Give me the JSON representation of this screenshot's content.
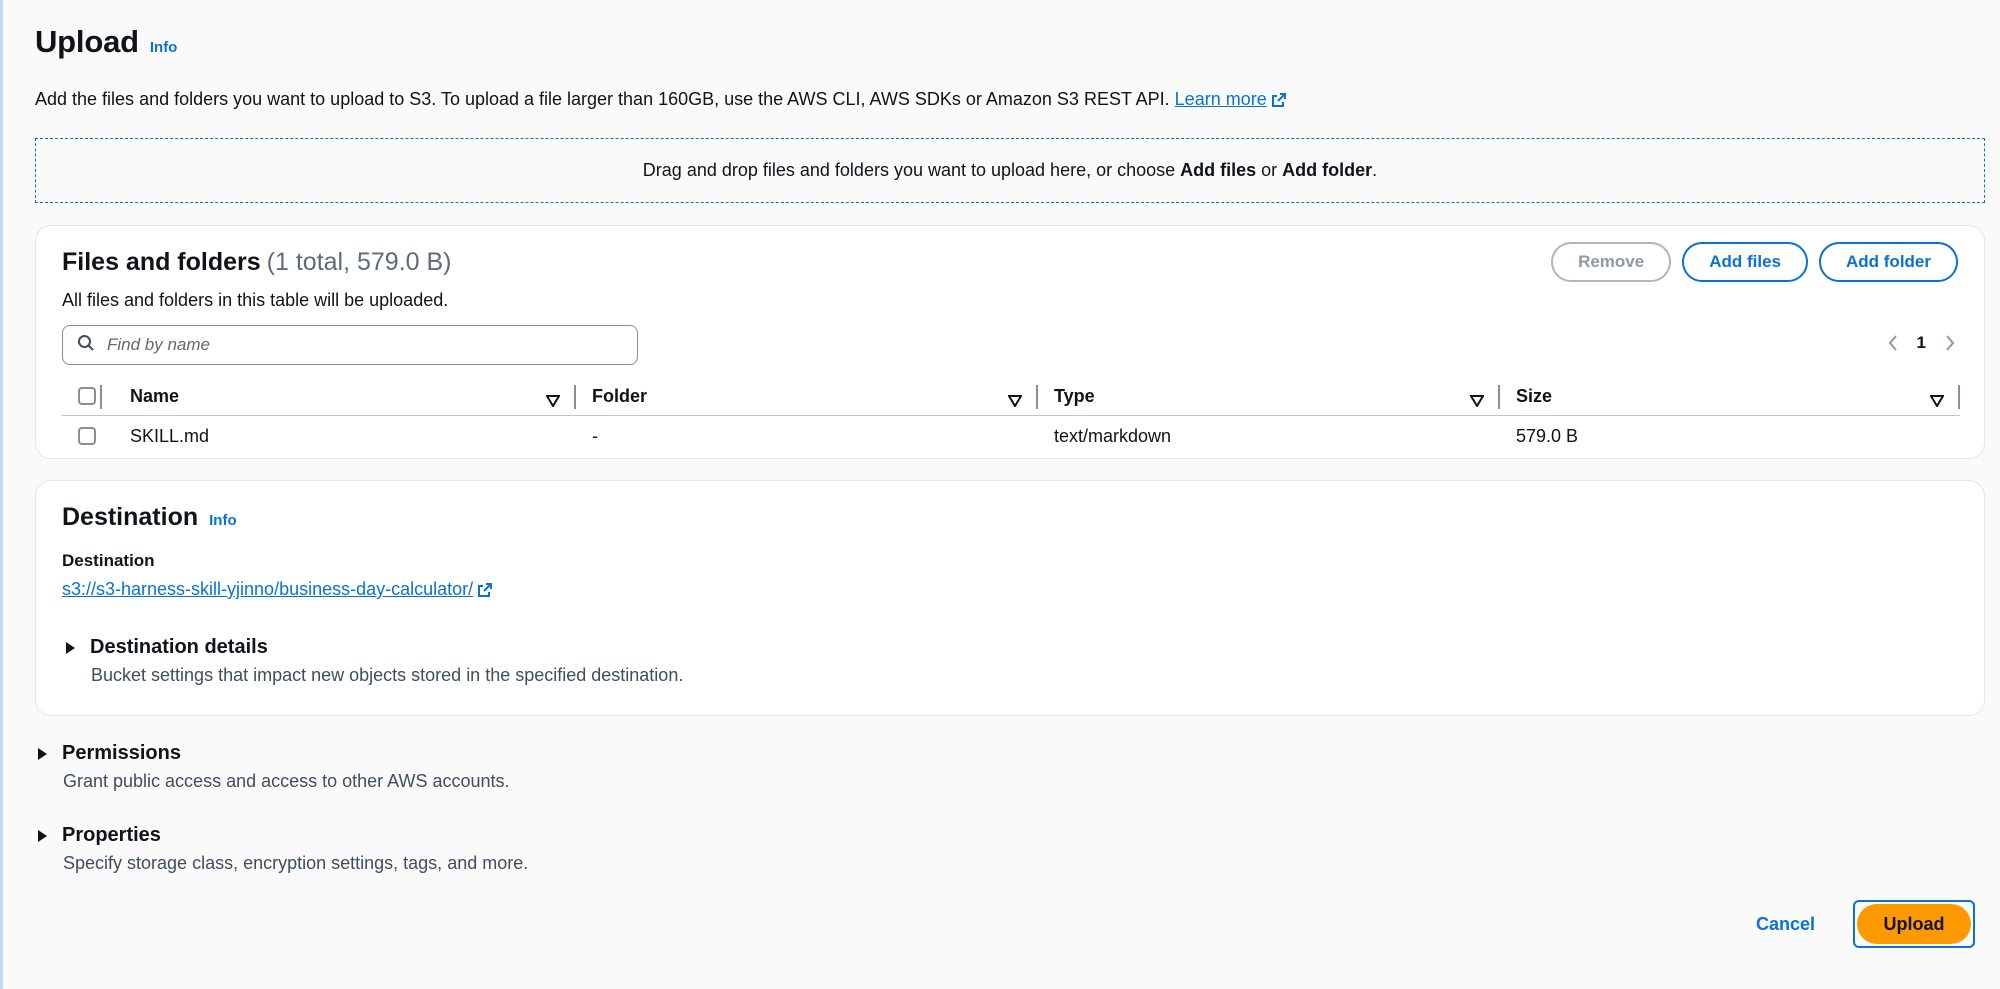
{
  "header": {
    "title": "Upload",
    "info_label": "Info",
    "description": "Add the files and folders you want to upload to S3. To upload a file larger than 160GB, use the AWS CLI, AWS SDKs or Amazon S3 REST API.",
    "learn_more": "Learn more"
  },
  "dropzone": {
    "text_before": "Drag and drop files and folders you want to upload here, or choose ",
    "add_files": "Add files",
    "or": " or ",
    "add_folder": "Add folder",
    "period": "."
  },
  "files": {
    "title": "Files and folders",
    "count": "(1 total, 579.0 B)",
    "subtitle": "All files and folders in this table will be uploaded.",
    "remove_label": "Remove",
    "add_files_label": "Add files",
    "add_folder_label": "Add folder",
    "search_placeholder": "Find by name",
    "current_page": "1",
    "columns": [
      "Name",
      "Folder",
      "Type",
      "Size"
    ],
    "rows": [
      {
        "name": "SKILL.md",
        "folder": "-",
        "type": "text/markdown",
        "size": "579.0 B"
      }
    ]
  },
  "destination": {
    "title": "Destination",
    "info_label": "Info",
    "label": "Destination",
    "uri": "s3://s3-harness-skill-yjinno/business-day-calculator/",
    "details_title": "Destination details",
    "details_desc": "Bucket settings that impact new objects stored in the specified destination."
  },
  "permissions": {
    "title": "Permissions",
    "desc": "Grant public access and access to other AWS accounts."
  },
  "properties": {
    "title": "Properties",
    "desc": "Specify storage class, encryption settings, tags, and more."
  },
  "footer": {
    "cancel_label": "Cancel",
    "upload_label": "Upload"
  },
  "colors": {
    "accent": "#0972d3",
    "primary_button": "#ff9900"
  }
}
